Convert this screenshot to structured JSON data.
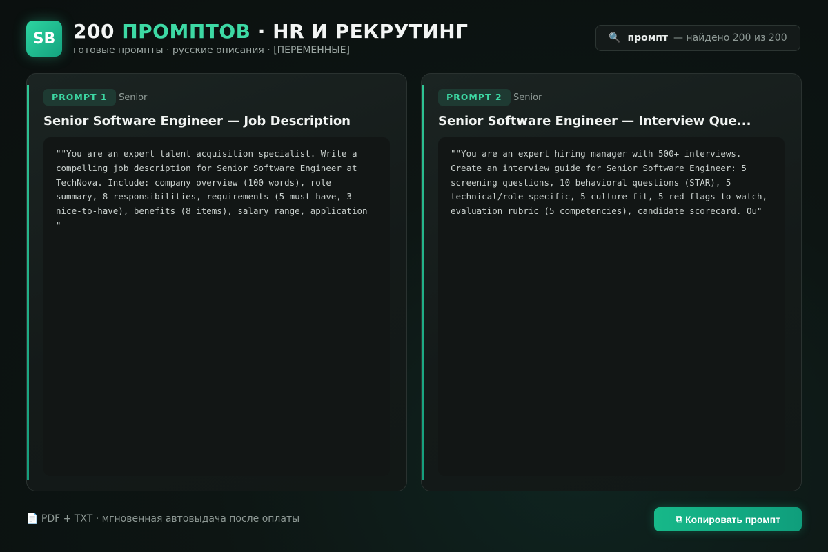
{
  "header": {
    "logo_text": "SB",
    "title_prefix": "200 ",
    "title_accent": "ПРОМПТОВ",
    "title_suffix": " · HR И РЕКРУТИНГ",
    "subtitle": "готовые промпты · русские описания · [ПЕРЕМЕННЫЕ]"
  },
  "search": {
    "icon": "🔍",
    "query": "промпт",
    "result": "— найдено 200 из 200"
  },
  "cards": [
    {
      "badge": "PROMPT 1",
      "level": "Senior",
      "title": "Senior Software Engineer — Job Description",
      "text": "\"\"You are an expert talent acquisition specialist. Write a compelling job description for Senior Software Engineer at TechNova. Include: company overview (100 words), role summary, 8 responsibilities, requirements (5 must-have, 3 nice-to-have), benefits (8 items), salary range, application \""
    },
    {
      "badge": "PROMPT 2",
      "level": "Senior",
      "title": "Senior Software Engineer — Interview Que...",
      "text": "\"\"You are an expert hiring manager with 500+ interviews. Create an interview guide for Senior Software Engineer: 5 screening questions, 10 behavioral questions (STAR), 5 technical/role-specific, 5 culture fit, 5 red flags to watch, evaluation rubric (5 competencies), candidate scorecard. Ou\""
    }
  ],
  "footer": {
    "note_icon": "📄",
    "note": "PDF + TXT · мгновенная автовыдача после оплаты",
    "copy_icon": "⧉",
    "copy_label": "Копировать промпт"
  },
  "colors": {
    "accent": "#3dd9a4",
    "button": "#17b889",
    "background": "#0d1513"
  }
}
